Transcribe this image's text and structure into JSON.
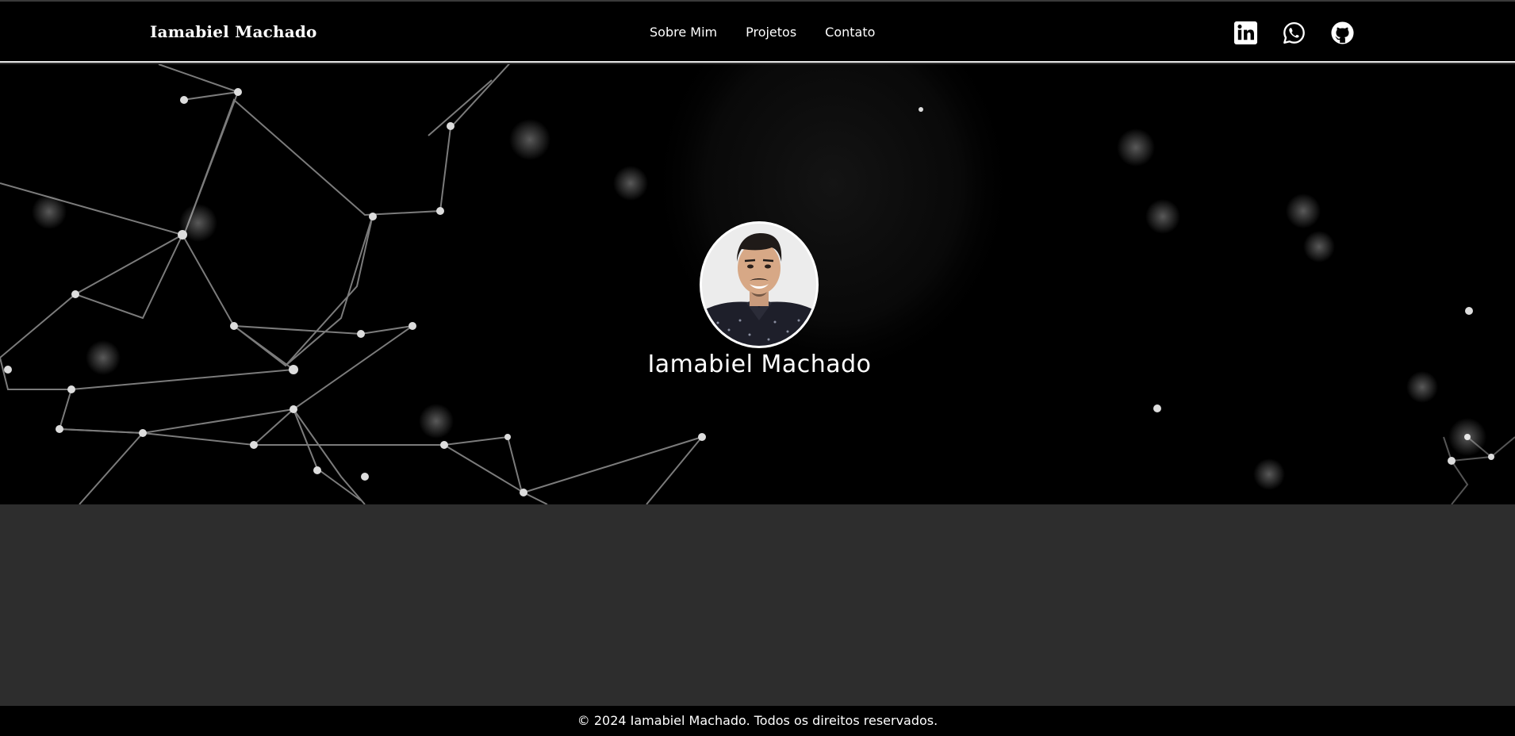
{
  "header": {
    "brand": "Iamabiel Machado",
    "nav": [
      "Sobre Mim",
      "Projetos",
      "Contato"
    ],
    "social": [
      {
        "icon": "linkedin-icon"
      },
      {
        "icon": "whatsapp-icon"
      },
      {
        "icon": "github-icon"
      }
    ]
  },
  "hero": {
    "name": "Iamabiel Machado",
    "avatar_alt": "profile-photo"
  },
  "footer": {
    "text": "© 2024 Iamabiel Machado. Todos os direitos reservados."
  },
  "colors": {
    "header_bg": "#000000",
    "hero_bg": "#000000",
    "content_bg": "#2d2d2d",
    "text": "#ffffff",
    "divider": "#e6e6e6"
  }
}
